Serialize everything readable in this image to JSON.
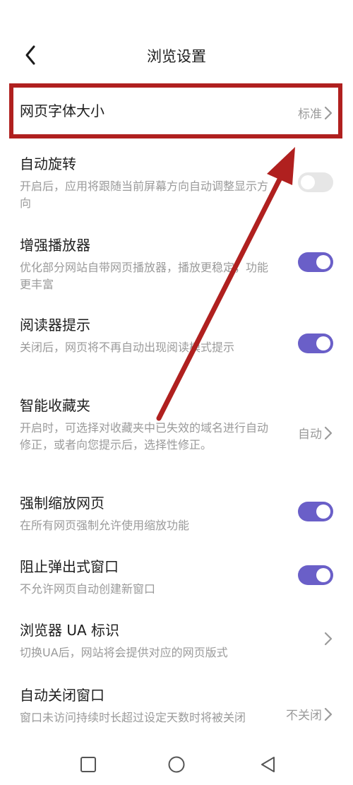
{
  "header": {
    "title": "浏览设置",
    "back_icon": "chevron-left-icon"
  },
  "settings": [
    {
      "id": "font-size",
      "title": "网页字体大小",
      "value": "标准",
      "control": "chevron"
    },
    {
      "id": "auto-rotate",
      "title": "自动旋转",
      "description": "开启后，应用将跟随当前屏幕方向自动调整显示方向",
      "control": "toggle",
      "state": "off"
    },
    {
      "id": "player-enhance",
      "title": "增强播放器",
      "description": "优化部分网站自带网页播放器，播放更稳定，功能更丰富",
      "control": "toggle",
      "state": "on"
    },
    {
      "id": "reader-tip",
      "title": "阅读器提示",
      "description": "关闭后，网页将不再自动出现阅读模式提示",
      "control": "toggle",
      "state": "on"
    },
    {
      "id": "smart-favorites",
      "title": "智能收藏夹",
      "description": "开启时，可选择对收藏夹中已失效的域名进行自动修正，或者向您提示后，选择性修正。",
      "value": "自动",
      "control": "chevron"
    },
    {
      "id": "force-zoom",
      "title": "强制缩放网页",
      "description": "在所有网页强制允许使用缩放功能",
      "control": "toggle",
      "state": "on"
    },
    {
      "id": "block-popups",
      "title": "阻止弹出式窗口",
      "description": "不允许网页自动创建新窗口",
      "control": "toggle",
      "state": "on"
    },
    {
      "id": "ua",
      "title": "浏览器 UA 标识",
      "description": "切换UA后，网站将会提供对应的网页版式",
      "control": "chevron"
    },
    {
      "id": "auto-close",
      "title": "自动关闭窗口",
      "description": "窗口未访问持续时长超过设定天数时将被关闭",
      "value": "不关闭",
      "control": "chevron"
    }
  ],
  "colors": {
    "accent": "#6a5fc8",
    "annotation": "#b0201f",
    "toggle_off": "#e6e6e6",
    "muted_text": "#9a9a9a"
  },
  "navbar": {
    "icons": [
      "square-icon",
      "circle-icon",
      "triangle-back-icon"
    ]
  }
}
